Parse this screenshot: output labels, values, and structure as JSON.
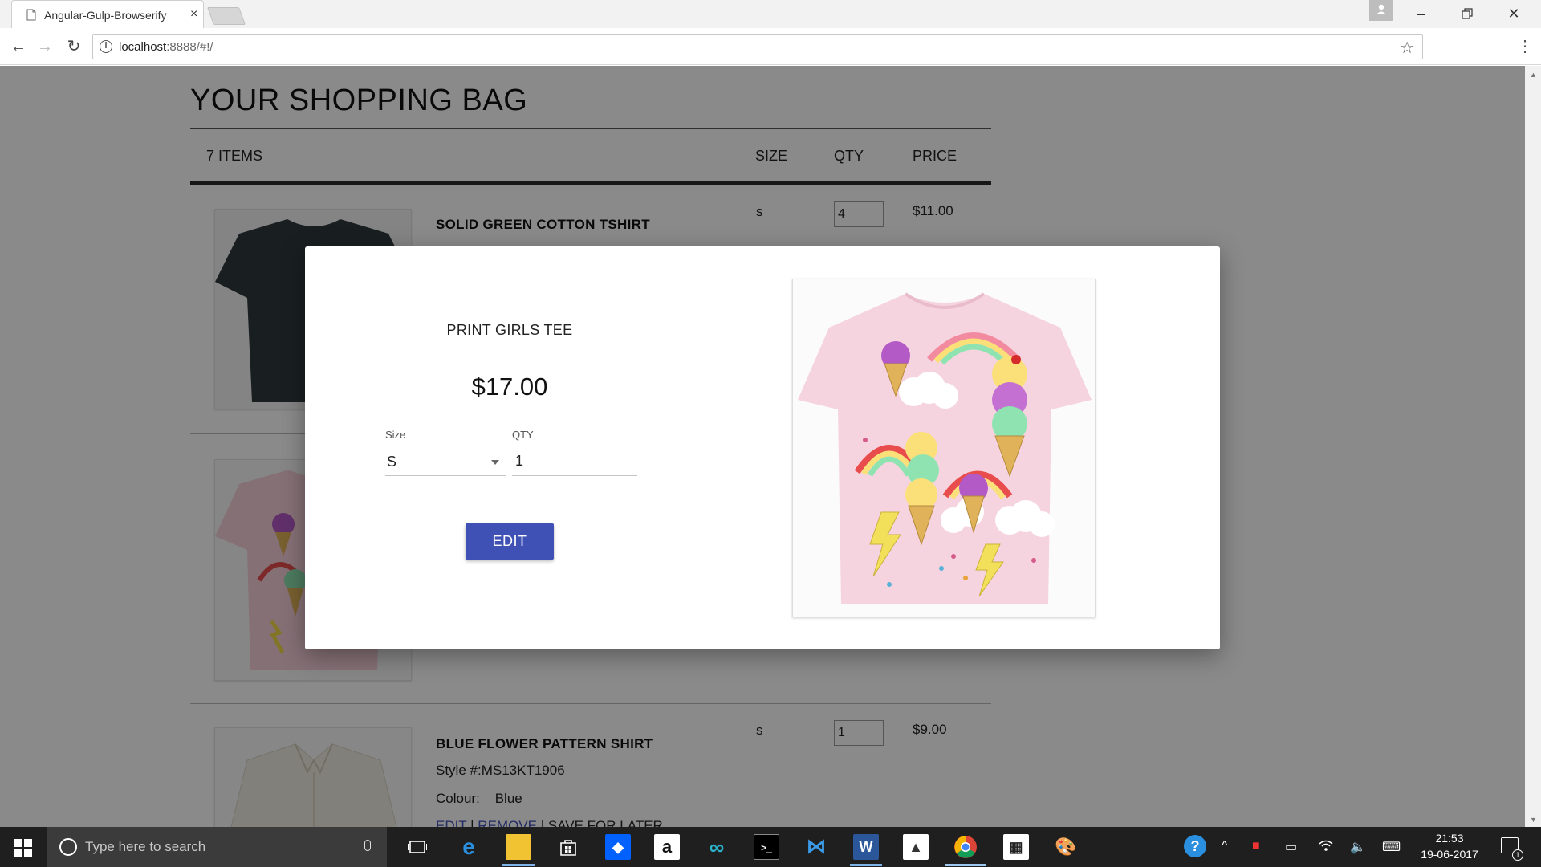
{
  "browser": {
    "tab_title": "Angular-Gulp-Browserify",
    "url_host": "localhost",
    "url_rest": ":8888/#!/"
  },
  "page": {
    "title": "YOUR SHOPPING BAG",
    "items_count": "7 ITEMS",
    "columns": {
      "size": "SIZE",
      "qty": "QTY",
      "price": "PRICE"
    }
  },
  "items": [
    {
      "name": "SOLID GREEN COTTON TSHIRT",
      "size": "s",
      "qty": "4",
      "price": "$11.00",
      "image_icon": "dark-tshirt-image"
    },
    {
      "name": "PRINT GIRLS TEE",
      "image_icon": "pink-tshirt-image"
    },
    {
      "name": "BLUE FLOWER PATTERN SHIRT",
      "style_label": "Style #:",
      "style": "MS13KT1906",
      "colour_label": "Colour:",
      "colour": "Blue",
      "size": "s",
      "qty": "1",
      "price": "$9.00",
      "links": {
        "edit": "EDIT",
        "remove": "REMOVE",
        "save": "SAVE FOR LATER"
      },
      "image_icon": "white-shirt-image"
    }
  ],
  "modal": {
    "product_name": "PRINT GIRLS TEE",
    "price": "$17.00",
    "size_label": "Size",
    "size_value": "S",
    "qty_label": "QTY",
    "qty_value": "1",
    "edit_label": "EDIT",
    "accent_color": "#3f51b5"
  },
  "taskbar": {
    "search_placeholder": "Type here to search",
    "time": "21:53",
    "date": "19-06-2017",
    "notification_count": "1"
  }
}
